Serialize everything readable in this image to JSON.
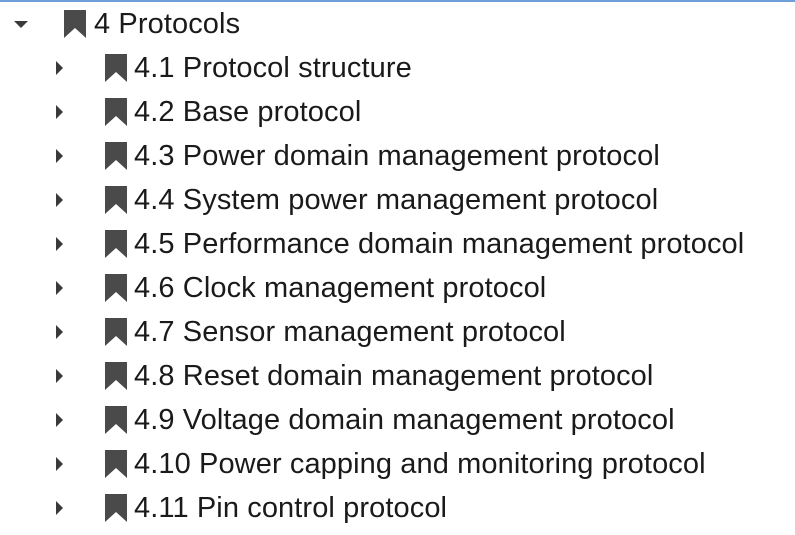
{
  "root": {
    "label": "4 Protocols",
    "expanded": true,
    "icon": "bookmark-icon",
    "children": [
      {
        "label": "4.1 Protocol structure"
      },
      {
        "label": "4.2 Base protocol"
      },
      {
        "label": "4.3 Power domain management protocol"
      },
      {
        "label": "4.4 System power management protocol"
      },
      {
        "label": "4.5 Performance domain management protocol"
      },
      {
        "label": "4.6 Clock management protocol"
      },
      {
        "label": "4.7 Sensor management protocol"
      },
      {
        "label": "4.8 Reset domain management protocol"
      },
      {
        "label": "4.9 Voltage domain management protocol"
      },
      {
        "label": "4.10  Power capping and monitoring protocol"
      },
      {
        "label": "4.11 Pin control protocol"
      }
    ]
  },
  "colors": {
    "icon": "#4a4a4a",
    "twisty": "#3a3a3a",
    "text": "#1a1a1a",
    "top_border": "#6f9fd8"
  }
}
